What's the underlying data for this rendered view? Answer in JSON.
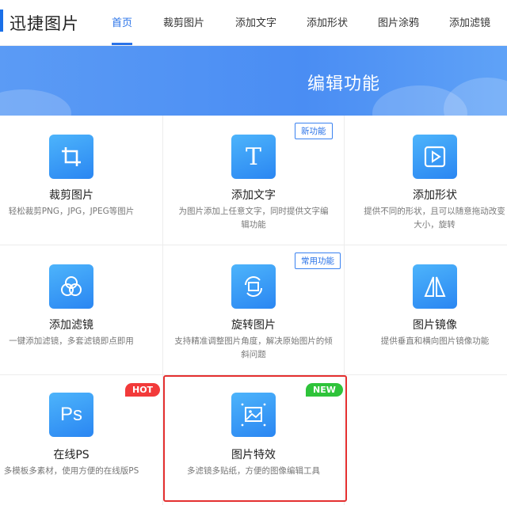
{
  "header": {
    "logo": "迅捷图片",
    "nav": [
      "首页",
      "裁剪图片",
      "添加文字",
      "添加形状",
      "图片涂鸦",
      "添加滤镜"
    ]
  },
  "banner": {
    "title": "编辑功能"
  },
  "cards": [
    {
      "title": "裁剪图片",
      "desc": "轻松裁剪PNG，JPG，JPEG等图片",
      "icon": "crop-icon"
    },
    {
      "title": "添加文字",
      "desc": "为图片添加上任意文字，同时提供文字编辑功能",
      "icon": "text-icon",
      "badge": "新功能"
    },
    {
      "title": "添加形状",
      "desc": "提供不同的形状，且可以随意拖动改变大小，旋转",
      "icon": "shape-play-icon"
    },
    {
      "title": "添加滤镜",
      "desc": "一键添加滤镜，多套滤镜即点即用",
      "icon": "filter-circles-icon"
    },
    {
      "title": "旋转图片",
      "desc": "支持精准调整图片角度，解决原始图片的倾斜问题",
      "icon": "rotate-icon",
      "badge": "常用功能"
    },
    {
      "title": "图片镜像",
      "desc": "提供垂直和横向图片镜像功能",
      "icon": "mirror-icon"
    },
    {
      "title": "在线PS",
      "desc": "多模板多素材，使用方便的在线版PS",
      "icon": "ps-icon",
      "badge": "HOT"
    },
    {
      "title": "图片特效",
      "desc": "多滤镜多贴纸，方便的图像编辑工具",
      "icon": "image-effect-icon",
      "badge": "NEW"
    }
  ],
  "colors": {
    "accent": "#2a73e8",
    "hot": "#f23a3a",
    "new": "#2ec33a",
    "highlight": "#e43030"
  }
}
